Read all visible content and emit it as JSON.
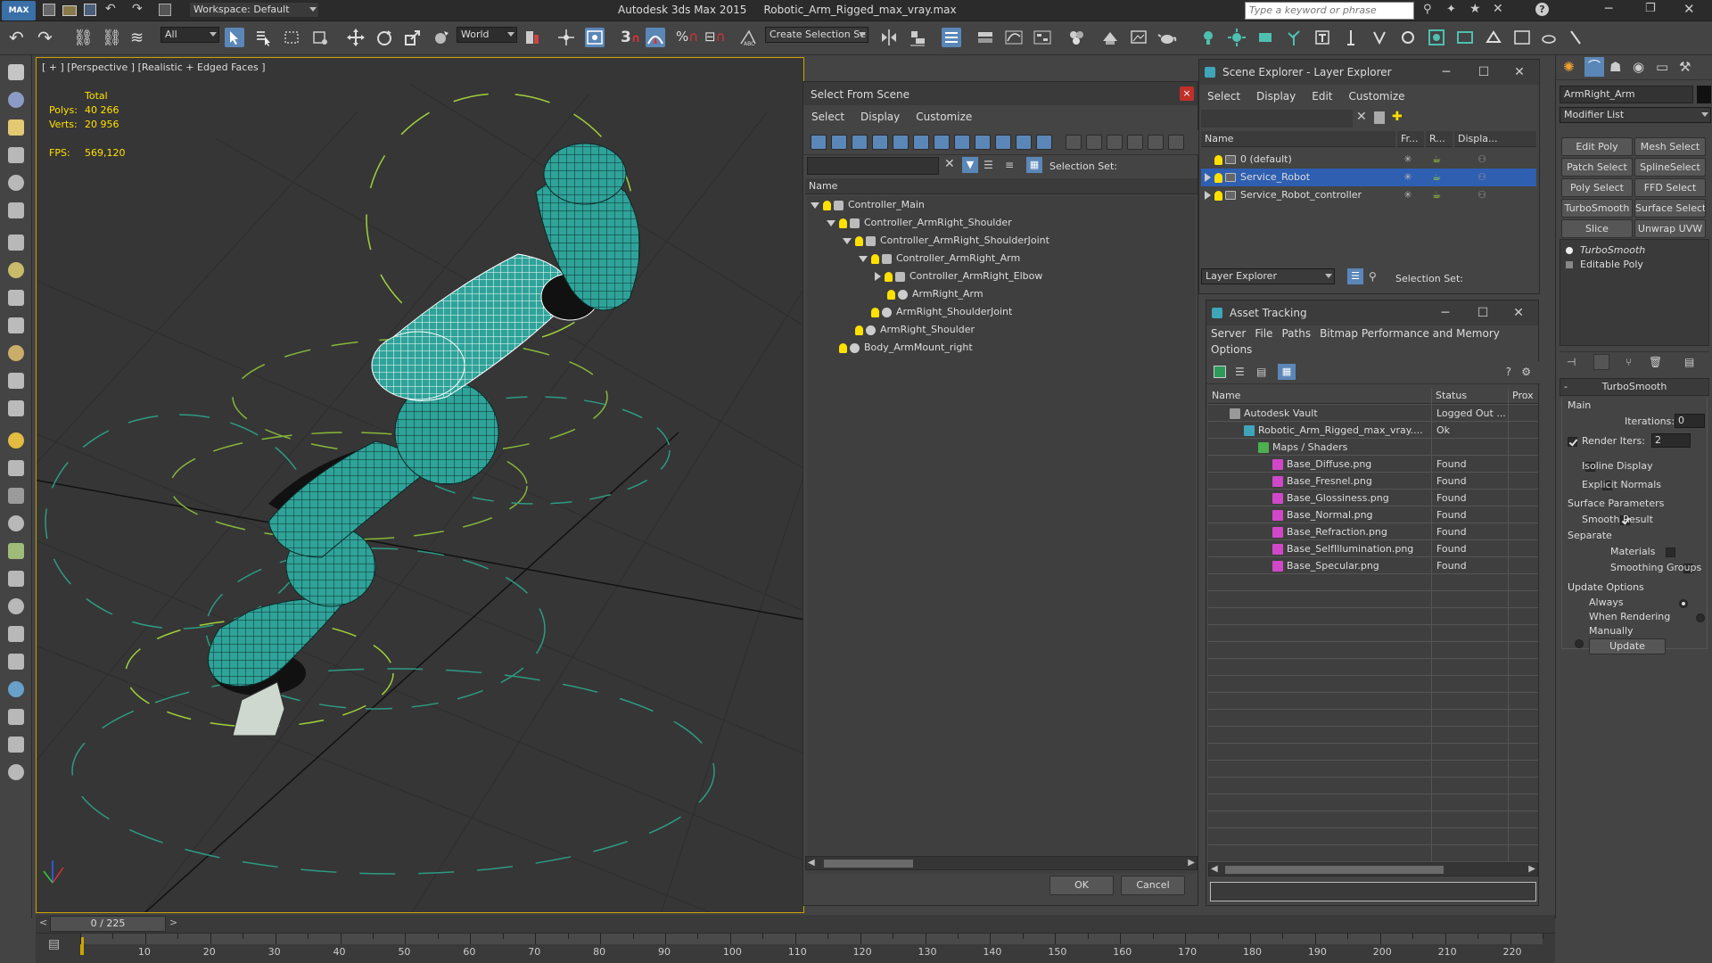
{
  "app": {
    "title": "Autodesk 3ds Max  2015",
    "file": "Robotic_Arm_Rigged_max_vray.max",
    "workspace": "Workspace: Default",
    "search_placeholder": "Type a keyword or phrase",
    "logo": "MAX"
  },
  "toolbar": {
    "filter_value": "All",
    "coord_value": "World",
    "snap_label": "3",
    "selection_set_placeholder": "Create Selection Se"
  },
  "viewport": {
    "label": "[ + ] [Perspective ] [Realistic + Edged Faces ]",
    "stats": {
      "total_label": "Total",
      "polys_label": "Polys:",
      "polys_value": "40 266",
      "verts_label": "Verts:",
      "verts_value": "20 956",
      "fps_label": "FPS:",
      "fps_value": "569,120"
    }
  },
  "select_from_scene": {
    "title": "Select From Scene",
    "menu": [
      "Select",
      "Display",
      "Customize"
    ],
    "selection_set_label": "Selection Set:",
    "column_name": "Name",
    "items": [
      {
        "label": "Controller_Main",
        "depth": 0,
        "expander": "down",
        "icon": "controller"
      },
      {
        "label": "Controller_ArmRight_Shoulder",
        "depth": 1,
        "expander": "down",
        "icon": "controller"
      },
      {
        "label": "Controller_ArmRight_ShoulderJoint",
        "depth": 2,
        "expander": "down",
        "icon": "controller"
      },
      {
        "label": "Controller_ArmRight_Arm",
        "depth": 3,
        "expander": "down",
        "icon": "controller"
      },
      {
        "label": "Controller_ArmRight_Elbow",
        "depth": 4,
        "expander": "right",
        "icon": "controller"
      },
      {
        "label": "ArmRight_Arm",
        "depth": 4,
        "expander": "none",
        "icon": "object"
      },
      {
        "label": "ArmRight_ShoulderJoint",
        "depth": 3,
        "expander": "none",
        "icon": "object"
      },
      {
        "label": "ArmRight_Shoulder",
        "depth": 2,
        "expander": "none",
        "icon": "object"
      },
      {
        "label": "Body_ArmMount_right",
        "depth": 1,
        "expander": "none",
        "icon": "object"
      }
    ],
    "ok_label": "OK",
    "cancel_label": "Cancel"
  },
  "scene_explorer": {
    "title": "Scene Explorer - Layer Explorer",
    "menu": [
      "Select",
      "Display",
      "Edit",
      "Customize"
    ],
    "columns": [
      "Name",
      "Fr...",
      "R...",
      "Displa..."
    ],
    "layers": [
      {
        "label": "0 (default)",
        "selected": false,
        "expander": false
      },
      {
        "label": "Service_Robot",
        "selected": true,
        "expander": true
      },
      {
        "label": "Service_Robot_controller",
        "selected": false,
        "expander": true
      }
    ],
    "footer_dropdown": "Layer Explorer",
    "selection_set_label": "Selection Set:"
  },
  "asset_tracking": {
    "title": "Asset Tracking",
    "menu": [
      "Server",
      "File",
      "Paths",
      "Bitmap Performance and Memory"
    ],
    "menu2": [
      "Options"
    ],
    "columns": [
      "Name",
      "Status",
      "Prox"
    ],
    "rows": [
      {
        "name": "Autodesk Vault",
        "status": "Logged Out ...",
        "depth": 0,
        "icon": "vault"
      },
      {
        "name": "Robotic_Arm_Rigged_max_vray....",
        "status": "Ok",
        "depth": 1,
        "icon": "max"
      },
      {
        "name": "Maps / Shaders",
        "status": "",
        "depth": 2,
        "icon": "maps"
      },
      {
        "name": "Base_Diffuse.png",
        "status": "Found",
        "depth": 3,
        "icon": "png"
      },
      {
        "name": "Base_Fresnel.png",
        "status": "Found",
        "depth": 3,
        "icon": "png"
      },
      {
        "name": "Base_Glossiness.png",
        "status": "Found",
        "depth": 3,
        "icon": "png"
      },
      {
        "name": "Base_Normal.png",
        "status": "Found",
        "depth": 3,
        "icon": "png"
      },
      {
        "name": "Base_Refraction.png",
        "status": "Found",
        "depth": 3,
        "icon": "png"
      },
      {
        "name": "Base_SelfIllumination.png",
        "status": "Found",
        "depth": 3,
        "icon": "png"
      },
      {
        "name": "Base_Specular.png",
        "status": "Found",
        "depth": 3,
        "icon": "png"
      }
    ]
  },
  "command_panel": {
    "object_name": "ArmRight_Arm",
    "modifier_list": "Modifier List",
    "buttons": [
      "Edit Poly",
      "Mesh Select",
      "Patch Select",
      "SplineSelect",
      "Poly Select",
      "FFD Select",
      "TurboSmooth",
      "Surface Select",
      "Slice",
      "Unwrap UVW"
    ],
    "stack": [
      "TurboSmooth",
      "Editable Poly"
    ],
    "rollout_title": "TurboSmooth",
    "main_label": "Main",
    "iterations_label": "Iterations:",
    "iterations_value": "0",
    "render_iters_label": "Render Iters:",
    "render_iters_value": "2",
    "isoline_label": "Isoline Display",
    "explicit_label": "Explicit Normals",
    "surface_params_label": "Surface Parameters",
    "smooth_result_label": "Smooth Result",
    "separate_label": "Separate",
    "materials_label": "Materials",
    "smoothing_groups_label": "Smoothing Groups",
    "update_options_label": "Update Options",
    "always_label": "Always",
    "when_rendering_label": "When Rendering",
    "manually_label": "Manually",
    "update_button": "Update"
  },
  "timeline": {
    "frame": "0 / 225",
    "ticks": [
      "10",
      "20",
      "30",
      "40",
      "50",
      "60",
      "70",
      "80",
      "90",
      "100",
      "110",
      "120",
      "130",
      "140",
      "150",
      "160",
      "170",
      "180",
      "190",
      "200",
      "210",
      "220"
    ]
  },
  "colors": {
    "accent": "#5b87b8",
    "selection": "#2e5fb0",
    "viewport_border": "#c9a400",
    "mesh": "#2fa39a",
    "controller": "#a0d23a",
    "stats": "#ffe000"
  }
}
